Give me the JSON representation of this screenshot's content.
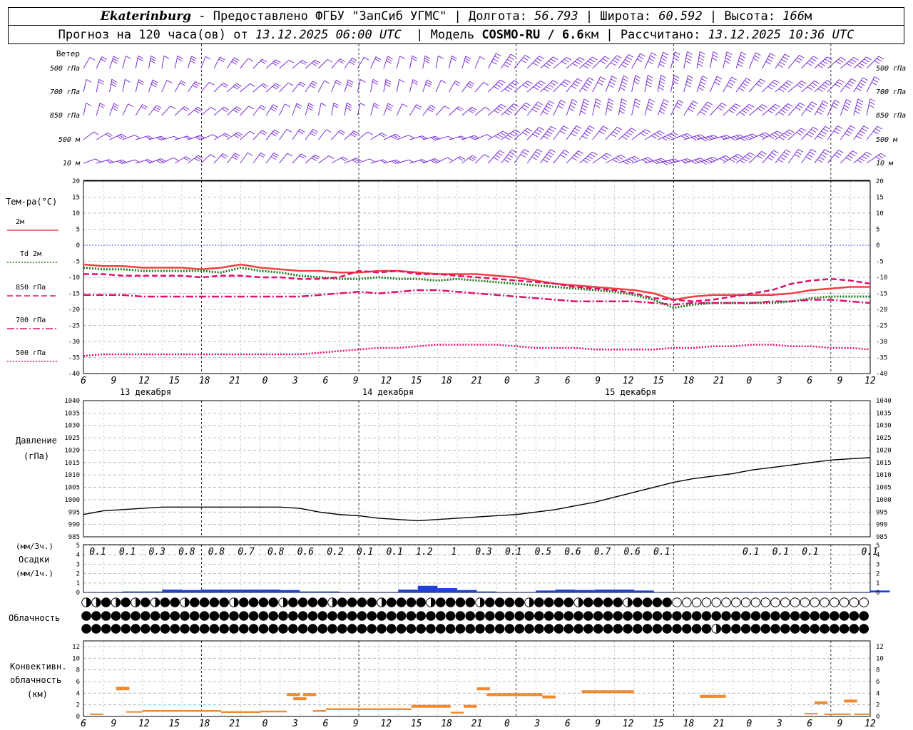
{
  "header": {
    "city": "Ekaterinburg",
    "provider": "Предоставлено ФГБУ \"ЗапСиб УГМС\"",
    "lon_label": "Долгота:",
    "lon": "56.793",
    "lat_label": "Широта:",
    "lat": "60.592",
    "alt_label": "Высота:",
    "alt": "166",
    "alt_unit": "м",
    "forecast_label": "Прогноз на 120 часа(ов) от",
    "forecast_time": "13.12.2025 06:00 UTC",
    "model_label": "Модель",
    "model": "COSMO-RU / 6.6",
    "model_unit": "км",
    "calc_label": "Рассчитано:",
    "calc_time": "13.12.2025 10:36 UTC"
  },
  "wind": {
    "title": "Ветер",
    "levels": [
      "500 гПа",
      "700 гПа",
      "850 гПа",
      "500 м",
      "10  м"
    ],
    "color": "#7b2fd6"
  },
  "temperature": {
    "title": "Тем-ра(°C)",
    "legend": [
      {
        "label": "2м",
        "color": "#f04040",
        "style": "solid"
      },
      {
        "label": "Td  2м",
        "color": "#1a7a1a",
        "style": "dotted"
      },
      {
        "label": "850 гПа",
        "color": "#e0106e",
        "style": "dashed"
      },
      {
        "label": "700 гПа",
        "color": "#e0106e",
        "style": "dashdot"
      },
      {
        "label": "500 гПа",
        "color": "#e0106e",
        "style": "finedot"
      }
    ],
    "yticks": [
      "20",
      "15",
      "10",
      "5",
      "0",
      "-5",
      "-10",
      "-15",
      "-20",
      "-25",
      "-30",
      "-35",
      "-40"
    ]
  },
  "time_axis": {
    "hours": [
      "6",
      "9",
      "12",
      "15",
      "18",
      "21",
      "0",
      "3",
      "6",
      "9",
      "12",
      "15",
      "18",
      "21",
      "0",
      "3",
      "6",
      "9",
      "12",
      "15",
      "18",
      "21",
      "0",
      "3",
      "6",
      "9",
      "12"
    ],
    "days": [
      "13 декабря",
      "14 декабря",
      "15 декабря"
    ]
  },
  "pressure": {
    "title": "Давление",
    "unit": "(гПа)",
    "yticks": [
      "1040",
      "1035",
      "1030",
      "1025",
      "1020",
      "1015",
      "1010",
      "1005",
      "1000",
      "995",
      "990",
      "985"
    ]
  },
  "precip": {
    "unit3": "(мм/3ч.)",
    "title": "Осадки",
    "unit1": "(мм/1ч.)",
    "yticks": [
      "5",
      "4",
      "3",
      "2",
      "1",
      "0"
    ],
    "sums": [
      "0.1",
      "0.1",
      "0.3",
      "0.8",
      "0.8",
      "0.7",
      "0.8",
      "0.6",
      "0.2",
      "0.1",
      "0.1",
      "1.2",
      "1",
      "0.3",
      "0.1",
      "0.5",
      "0.6",
      "0.7",
      "0.6",
      "0.1",
      "",
      "",
      "0.1",
      "0.1",
      "0.1",
      "",
      "0.1"
    ]
  },
  "cloud": {
    "title": "Облачность"
  },
  "conv": {
    "title1": "Конвективн.",
    "title2": "облачность",
    "unit": "(км)",
    "yticks": [
      "12",
      "10",
      "8",
      "6",
      "4",
      "2",
      "0"
    ]
  },
  "chart_data": [
    {
      "type": "line",
      "title": "Тем-ра(°C)",
      "x_hours_from_start": [
        0,
        3,
        6,
        9,
        12,
        15,
        18,
        21,
        24,
        27,
        30,
        33,
        36,
        39,
        42,
        45,
        48,
        51,
        54,
        57,
        60,
        63,
        66,
        69,
        72,
        75,
        78,
        81,
        84,
        87,
        90,
        93,
        96,
        99,
        102,
        105,
        108,
        111,
        114,
        117,
        120
      ],
      "ylim": [
        -40,
        20
      ],
      "series": [
        {
          "name": "2м",
          "values": [
            -6,
            -6.5,
            -6.5,
            -7,
            -7,
            -7,
            -7.5,
            -7,
            -6,
            -7,
            -7.5,
            -8,
            -8,
            -8.5,
            -8.5,
            -8,
            -8,
            -8.5,
            -9,
            -9,
            -9,
            -9.5,
            -10,
            -11,
            -12,
            -12.5,
            -13,
            -13.5,
            -14,
            -15,
            -17,
            -16,
            -15.5,
            -15.5,
            -15.5,
            -15.5,
            -15,
            -14,
            -13.5,
            -13,
            -13
          ]
        },
        {
          "name": "Td  2м",
          "values": [
            -7,
            -7.5,
            -7.5,
            -8,
            -8,
            -8,
            -8,
            -8.5,
            -7,
            -8,
            -8.5,
            -9.5,
            -10,
            -10.5,
            -10.5,
            -10,
            -10.5,
            -10.5,
            -11,
            -10.5,
            -11,
            -11.5,
            -12,
            -12.5,
            -13,
            -13.5,
            -14,
            -14.5,
            -15.5,
            -17,
            -19.5,
            -18.5,
            -18,
            -18,
            -18,
            -18,
            -17.5,
            -16.5,
            -16,
            -16,
            -16
          ]
        },
        {
          "name": "850 гПа",
          "values": [
            -9,
            -9,
            -9.5,
            -9.5,
            -9.5,
            -9.5,
            -10,
            -9.5,
            -9.5,
            -10,
            -10,
            -10.5,
            -10.5,
            -10,
            -8,
            -8.5,
            -8,
            -9,
            -9,
            -9.5,
            -10,
            -10.5,
            -11,
            -11.5,
            -12,
            -13,
            -13.5,
            -14,
            -15,
            -16.5,
            -17,
            -17.5,
            -17,
            -16,
            -15,
            -14,
            -12,
            -11,
            -10.5,
            -11,
            -12
          ]
        },
        {
          "name": "700 гПа",
          "values": [
            -15.5,
            -15.5,
            -15.5,
            -16,
            -16,
            -16,
            -16,
            -16,
            -16,
            -16,
            -16,
            -16,
            -15.5,
            -15,
            -14.5,
            -15,
            -14.5,
            -14,
            -14,
            -14.5,
            -15,
            -15.5,
            -16,
            -16.5,
            -17,
            -17.5,
            -17.5,
            -17.5,
            -17.5,
            -18,
            -18.5,
            -18,
            -18,
            -18,
            -18,
            -17.5,
            -17.5,
            -17,
            -17,
            -17.5,
            -18
          ]
        },
        {
          "name": "500 гПа",
          "values": [
            -34.5,
            -34,
            -34,
            -34,
            -34,
            -34,
            -34,
            -34,
            -34,
            -34,
            -34,
            -34,
            -33.5,
            -33,
            -32.5,
            -32,
            -32,
            -31.5,
            -31,
            -31,
            -31,
            -31,
            -31.5,
            -32,
            -32,
            -32,
            -32.5,
            -32.5,
            -32.5,
            -32.5,
            -32,
            -32,
            -31.5,
            -31.5,
            -31,
            -31,
            -31.5,
            -31.5,
            -32,
            -32,
            -32.5
          ]
        }
      ]
    },
    {
      "type": "line",
      "title": "Давление",
      "ylabel": "(гПа)",
      "x_hours_from_start": [
        0,
        3,
        6,
        9,
        12,
        15,
        18,
        21,
        24,
        27,
        30,
        33,
        36,
        39,
        42,
        45,
        48,
        51,
        54,
        57,
        60,
        63,
        66,
        69,
        72,
        75,
        78,
        81,
        84,
        87,
        90,
        93,
        96,
        99,
        102,
        105,
        108,
        111,
        114,
        117,
        120
      ],
      "ylim": [
        985,
        1040
      ],
      "series": [
        {
          "name": "",
          "values": [
            994,
            995.5,
            996,
            996.5,
            997,
            997,
            997,
            997,
            997,
            997,
            997,
            996.5,
            995,
            994,
            993.5,
            992.5,
            992,
            991.5,
            992,
            992.5,
            993,
            993.5,
            994,
            995,
            996,
            997.5,
            999,
            1001,
            1003,
            1005,
            1007,
            1008.5,
            1009.5,
            1010.5,
            1012,
            1013,
            1014,
            1015,
            1016,
            1016.5,
            1017
          ]
        }
      ]
    },
    {
      "type": "bar",
      "title": "Осадки",
      "ylabel": "(мм/1ч.)",
      "ylim": [
        0,
        5
      ],
      "x_hours_from_start": [
        0,
        3,
        6,
        9,
        12,
        15,
        18,
        21,
        24,
        27,
        30,
        33,
        36,
        39,
        42,
        45,
        48,
        51,
        54,
        57,
        60,
        63,
        66,
        69,
        72,
        75,
        78,
        81,
        84,
        87,
        90,
        93,
        96,
        99,
        102,
        105,
        108,
        111,
        114,
        117,
        120
      ],
      "values": [
        0.03,
        0.05,
        0.1,
        0.1,
        0.3,
        0.25,
        0.3,
        0.3,
        0.3,
        0.3,
        0.25,
        0.1,
        0.1,
        0.05,
        0.05,
        0.05,
        0.3,
        0.7,
        0.45,
        0.25,
        0.1,
        0.05,
        0.05,
        0.2,
        0.3,
        0.25,
        0.3,
        0.3,
        0.2,
        0.05,
        0,
        0,
        0,
        0.05,
        0.03,
        0.05,
        0,
        0.03,
        0,
        0.05,
        0.2
      ]
    },
    {
      "type": "bar",
      "title": "Конвективн. облачность",
      "ylabel": "(км)",
      "ylim": [
        0,
        13
      ],
      "segments": [
        {
          "h0": 1,
          "h1": 3,
          "bottom": 0.4,
          "top": 0.5
        },
        {
          "h0": 5,
          "h1": 7,
          "bottom": 4.5,
          "top": 5.1
        },
        {
          "h0": 6.5,
          "h1": 9,
          "bottom": 0.7,
          "top": 0.9
        },
        {
          "h0": 9,
          "h1": 21,
          "bottom": 0.8,
          "top": 1.1
        },
        {
          "h0": 21,
          "h1": 27,
          "bottom": 0.6,
          "top": 0.9
        },
        {
          "h0": 27,
          "h1": 31,
          "bottom": 0.7,
          "top": 1.0
        },
        {
          "h0": 31,
          "h1": 33,
          "bottom": 3.5,
          "top": 4.0
        },
        {
          "h0": 32,
          "h1": 34,
          "bottom": 2.8,
          "top": 3.3
        },
        {
          "h0": 33.5,
          "h1": 35.5,
          "bottom": 3.5,
          "top": 4.0
        },
        {
          "h0": 35,
          "h1": 37,
          "bottom": 0.8,
          "top": 1.1
        },
        {
          "h0": 37,
          "h1": 50,
          "bottom": 1.1,
          "top": 1.4
        },
        {
          "h0": 50,
          "h1": 56,
          "bottom": 1.5,
          "top": 2.0
        },
        {
          "h0": 56,
          "h1": 58,
          "bottom": 0.5,
          "top": 0.8
        },
        {
          "h0": 58,
          "h1": 60,
          "bottom": 1.5,
          "top": 2.0
        },
        {
          "h0": 60,
          "h1": 62,
          "bottom": 4.5,
          "top": 5.0
        },
        {
          "h0": 61.5,
          "h1": 70,
          "bottom": 3.5,
          "top": 4.0
        },
        {
          "h0": 70,
          "h1": 72,
          "bottom": 3.1,
          "top": 3.6
        },
        {
          "h0": 76,
          "h1": 84,
          "bottom": 4.0,
          "top": 4.5
        },
        {
          "h0": 94,
          "h1": 98,
          "bottom": 3.2,
          "top": 3.7
        },
        {
          "h0": 110,
          "h1": 112,
          "bottom": 0.4,
          "top": 0.6
        },
        {
          "h0": 111.5,
          "h1": 113.5,
          "bottom": 2.1,
          "top": 2.6
        },
        {
          "h0": 113,
          "h1": 117,
          "bottom": 0.3,
          "top": 0.5
        },
        {
          "h0": 116,
          "h1": 118,
          "bottom": 2.4,
          "top": 2.9
        },
        {
          "h0": 117.5,
          "h1": 120,
          "bottom": 0.3,
          "top": 0.5
        }
      ]
    }
  ]
}
